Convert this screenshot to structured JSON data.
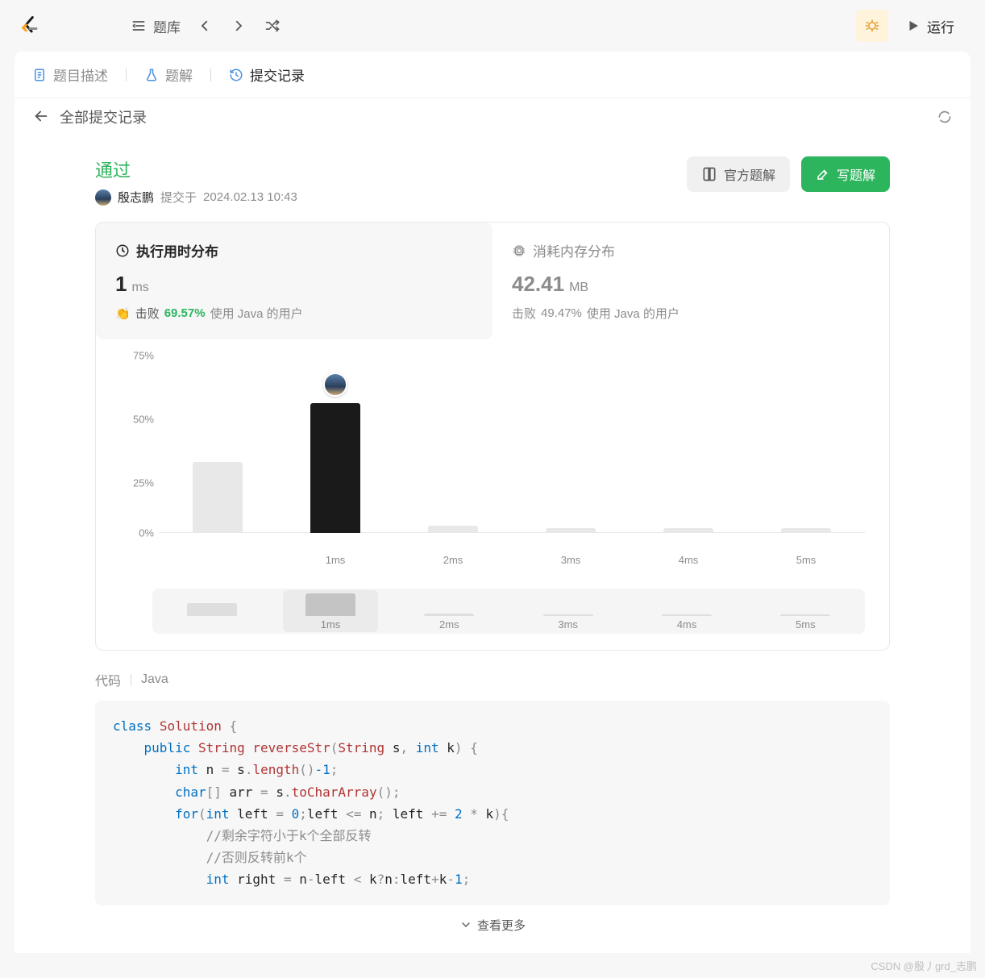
{
  "toolbar": {
    "problems_label": "题库",
    "run_label": "运行"
  },
  "tabs": {
    "description": "题目描述",
    "solution": "题解",
    "submissions": "提交记录"
  },
  "back": {
    "all_submissions": "全部提交记录"
  },
  "status": {
    "accepted": "通过",
    "username": "殷志鹏",
    "submitted_at_prefix": "提交于",
    "submitted_at": "2024.02.13 10:43",
    "official_solution": "官方题解",
    "write_solution": "写题解"
  },
  "stats": {
    "runtime": {
      "title": "执行用时分布",
      "value": "1",
      "unit": "ms",
      "beat_label": "击败",
      "beat_percent": "69.57%",
      "beat_suffix": "使用 Java 的用户"
    },
    "memory": {
      "title": "消耗内存分布",
      "value": "42.41",
      "unit": "MB",
      "beat_label": "击败",
      "beat_percent": "49.47%",
      "beat_suffix": "使用 Java 的用户"
    }
  },
  "chart_data": {
    "type": "bar",
    "title": "执行用时分布",
    "xlabel": "ms",
    "ylabel": "%",
    "ylim": [
      0,
      75
    ],
    "yticks": [
      "75%",
      "50%",
      "25%",
      "0%"
    ],
    "categories": [
      "",
      "1ms",
      "2ms",
      "3ms",
      "4ms",
      "5ms"
    ],
    "values": [
      30,
      55,
      3,
      2,
      2,
      2
    ],
    "highlighted_index": 1,
    "mini_categories": [
      "",
      "1ms",
      "2ms",
      "3ms",
      "4ms",
      "5ms"
    ],
    "mini_values": [
      16,
      28,
      3,
      2,
      2,
      2
    ],
    "mini_highlighted_index": 1
  },
  "code": {
    "label": "代码",
    "language": "Java",
    "show_more": "查看更多",
    "tokens": {
      "class": "class",
      "Solution": "Solution",
      "public": "public",
      "String": "String",
      "reverseStr": "reverseStr",
      "s": "s",
      "int": "int",
      "k": "k",
      "n": "n",
      "length": "length",
      "minus1": "-1",
      "char": "char",
      "arr": "arr",
      "toCharArray": "toCharArray",
      "for": "for",
      "left": "left",
      "zero": "0",
      "two": "2",
      "comment1": "//剩余字符小于k个全部反转",
      "comment2": "//否则反转前k个",
      "right": "right",
      "one": "1"
    }
  },
  "watermark": "CSDN @殷丿grd_志鹏"
}
